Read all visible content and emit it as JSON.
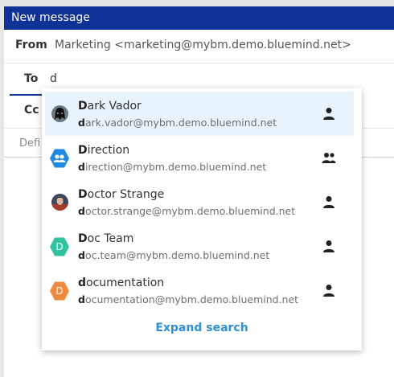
{
  "window": {
    "title": "New message"
  },
  "from": {
    "label": "From",
    "value": "Marketing <marketing@mybm.demo.bluemind.net>"
  },
  "to": {
    "label": "To",
    "value": "d"
  },
  "cc": {
    "label": "Cc"
  },
  "subject": {
    "placeholder": "Defi"
  },
  "suggestions": [
    {
      "name_match": "D",
      "name_rest": "ark Vador",
      "email_match": "d",
      "email_rest": "ark.vador@mybm.demo.bluemind.net",
      "avatar": "dark-vador-photo",
      "type": "person-icon",
      "highlighted": true
    },
    {
      "name_match": "D",
      "name_rest": "irection",
      "email_match": "d",
      "email_rest": "irection@mybm.demo.bluemind.net",
      "avatar": "group-hexagon",
      "avatar_color": "#1e88e5",
      "type": "group-icon"
    },
    {
      "name_match": "D",
      "name_rest": "octor Strange",
      "email_match": "d",
      "email_rest": "octor.strange@mybm.demo.bluemind.net",
      "avatar": "doctor-strange-photo",
      "type": "person-icon"
    },
    {
      "name_match": "D",
      "name_rest": "oc Team",
      "email_match": "d",
      "email_rest": "oc.team@mybm.demo.bluemind.net",
      "avatar": "letter-hexagon",
      "avatar_letter": "D",
      "avatar_color": "#2ec4a0",
      "type": "person-icon"
    },
    {
      "name_match": "d",
      "name_rest": "ocumentation",
      "email_match": "d",
      "email_rest": "ocumentation@mybm.demo.bluemind.net",
      "avatar": "letter-hexagon",
      "avatar_letter": "D",
      "avatar_color": "#f08a3c",
      "type": "person-icon"
    }
  ],
  "expand_label": "Expand search",
  "colors": {
    "titlebar": "#0f3296",
    "highlight": "#e8f3fb",
    "link": "#2f8fd8"
  }
}
